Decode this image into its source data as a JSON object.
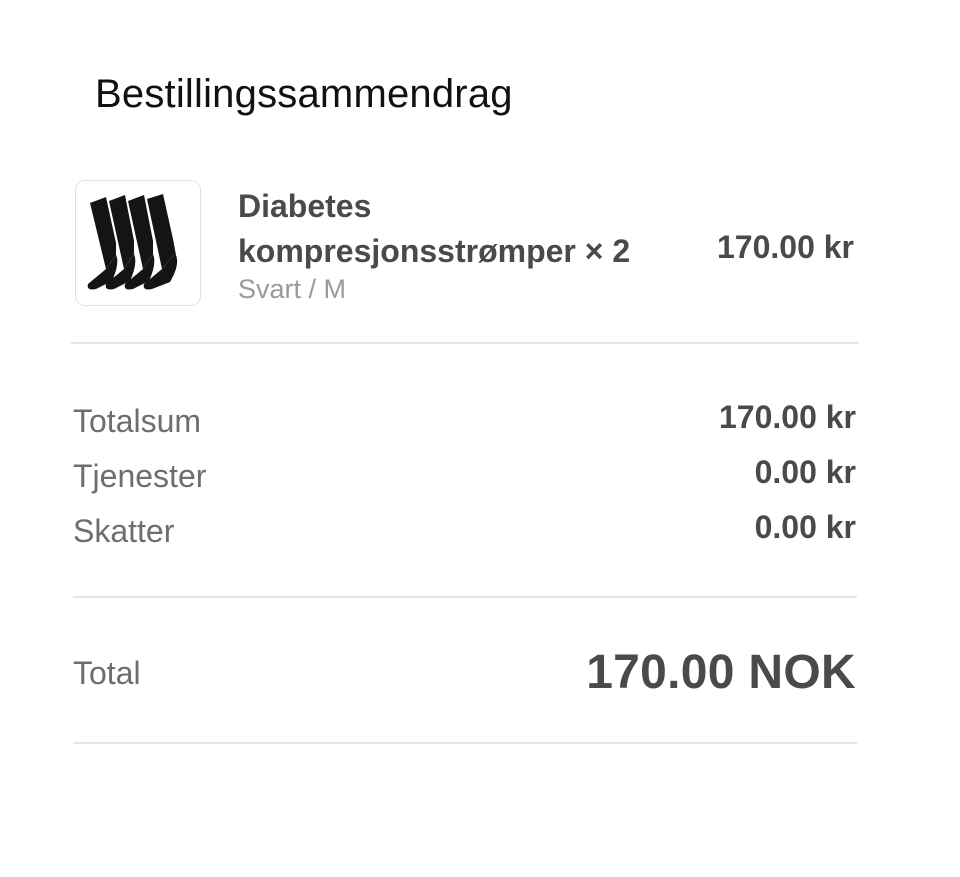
{
  "header": {
    "title": "Bestillingssammendrag"
  },
  "item": {
    "image_icon": "sock-product-image",
    "name": "Diabetes kompresjonsstrømper × 2",
    "variant": "Svart / M",
    "price": "170.00 kr"
  },
  "summary": {
    "rows": [
      {
        "label": "Totalsum",
        "value": "170.00 kr"
      },
      {
        "label": "Tjenester",
        "value": "0.00 kr"
      },
      {
        "label": "Skatter",
        "value": "0.00 kr"
      }
    ]
  },
  "total": {
    "label": "Total",
    "value": "170.00 NOK"
  },
  "colors": {
    "text_dark": "#111111",
    "text_main": "#4a4a4a",
    "text_muted": "#6e6e6e",
    "text_light": "#9a9a9a",
    "divider": "#e6e6e6",
    "sock": "#141414"
  }
}
